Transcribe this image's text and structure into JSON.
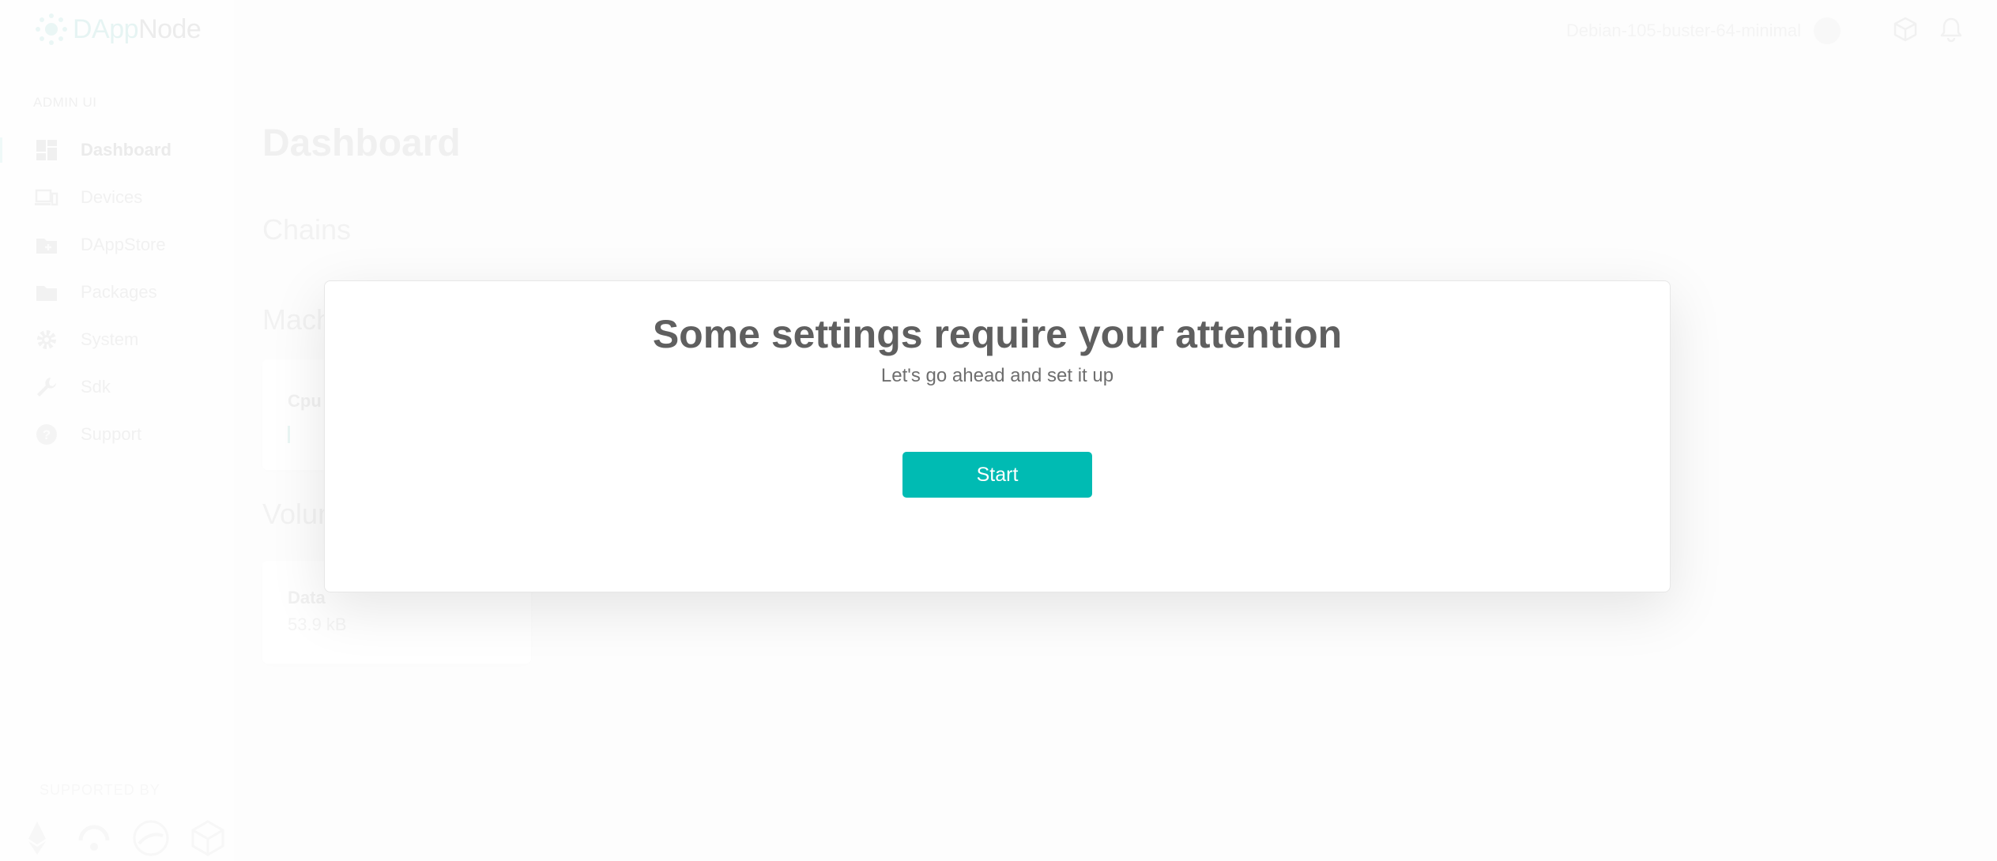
{
  "app": {
    "brand_prefix": "DApp",
    "brand_suffix": "Node",
    "accent_color": "#00bbb3"
  },
  "sidebar": {
    "section_label": "ADMIN UI",
    "items": [
      {
        "label": "Dashboard",
        "icon": "dashboard-icon",
        "active": true
      },
      {
        "label": "Devices",
        "icon": "devices-icon"
      },
      {
        "label": "DAppStore",
        "icon": "store-icon"
      },
      {
        "label": "Packages",
        "icon": "folder-icon"
      },
      {
        "label": "System",
        "icon": "gear-icon"
      },
      {
        "label": "Sdk",
        "icon": "wrench-icon"
      },
      {
        "label": "Support",
        "icon": "help-icon"
      }
    ],
    "supported_by_label": "SUPPORTED BY",
    "sponsors": [
      "ethereum-icon",
      "sponsor-2-icon",
      "sponsor-3-icon",
      "sponsor-4-icon"
    ]
  },
  "topbar": {
    "host_name": "Debian-105-buster-64-minimal",
    "icons": [
      "avatar",
      "package-icon",
      "bell-icon"
    ]
  },
  "main": {
    "page_title": "Dashboard",
    "sections": {
      "chains": "Chains",
      "machine": "Machine stats",
      "volumes": "Volumes"
    },
    "cards": {
      "cpu_title": "Cpu",
      "data_title": "Data",
      "data_value": "53.9 kB"
    }
  },
  "modal": {
    "title": "Some settings require your attention",
    "subtitle": "Let's go ahead and set it up",
    "button_label": "Start"
  }
}
